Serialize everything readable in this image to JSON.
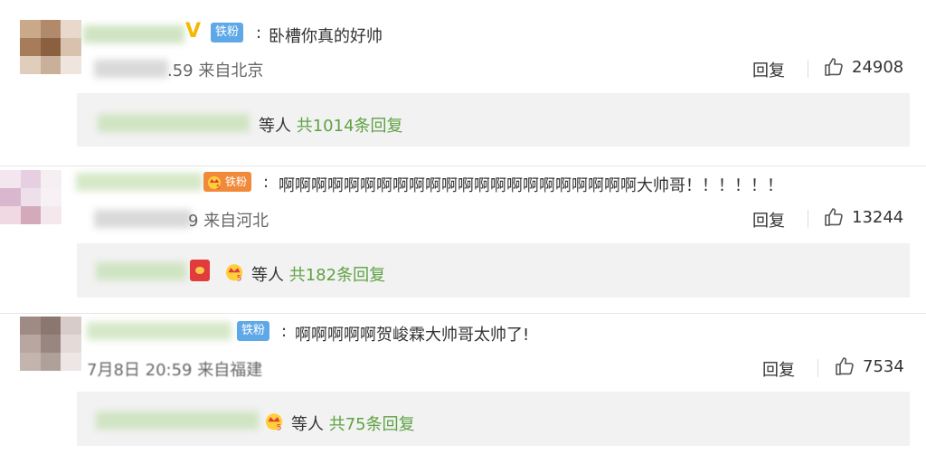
{
  "comments": [
    {
      "badge": "铁粉",
      "verified_mark": "V",
      "separator": ":",
      "text": "卧槽你真的好帅",
      "meta": ".59 来自北京",
      "reply_label": "回复",
      "likes": "24908",
      "sub_etc": "等人",
      "sub_count": "共1014条回复"
    },
    {
      "badge": "铁粉",
      "separator": ":",
      "text": "啊啊啊啊啊啊啊啊啊啊啊啊啊啊啊啊啊啊啊啊啊啊大帅哥！！！！！！",
      "meta": "9 来自河北",
      "reply_label": "回复",
      "likes": "13244",
      "sub_etc": "等人",
      "sub_count": "共182条回复"
    },
    {
      "badge": "铁粉",
      "separator": ":",
      "text": "啊啊啊啊啊贺峻霖大帅哥太帅了!",
      "meta": "7月8日 20:59 来自福建",
      "reply_label": "回复",
      "likes": "7534",
      "sub_etc": "等人",
      "sub_count": "共75条回复"
    }
  ]
}
